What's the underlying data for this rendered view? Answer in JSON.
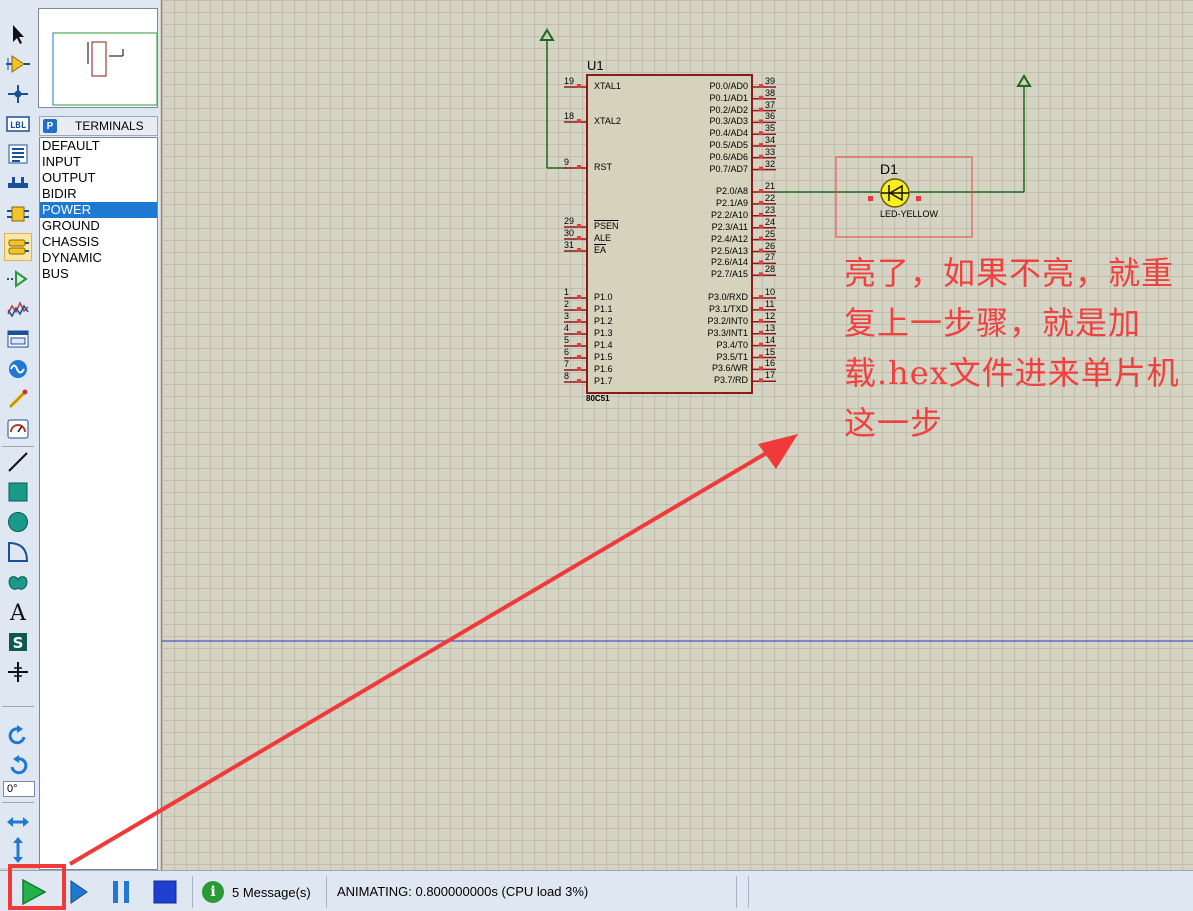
{
  "colors": {
    "annotation_red": "#f04040",
    "wire_green": "#1c6b1c",
    "chip_outline": "#8b1a1a",
    "chip_fill": "#d5d3bb",
    "selection_blue": "#1f78d1"
  },
  "toolbar": {
    "tools": [
      "selection-mode-icon",
      "component-mode-icon",
      "junction-dot-icon",
      "wire-label-icon",
      "text-script-icon",
      "buses-icon",
      "subcircuit-icon",
      "terminals-icon",
      "device-pins-icon",
      "graph-icon",
      "tape-recorder-icon",
      "generator-icon",
      "voltage-probe-icon",
      "virtual-instruments-icon",
      "line-icon",
      "box-icon",
      "circle-icon",
      "arc-icon",
      "closed-path-icon",
      "text-icon",
      "symbol-icon",
      "marker-icon",
      "rotate-clockwise-icon",
      "rotate-anticlockwise-icon",
      "mirror-x-icon",
      "mirror-y-icon"
    ],
    "angle_value": "0°"
  },
  "side_panel": {
    "badge": "P",
    "title": "TERMINALS",
    "items": [
      "DEFAULT",
      "INPUT",
      "OUTPUT",
      "BIDIR",
      "POWER",
      "GROUND",
      "CHASSIS",
      "DYNAMIC",
      "BUS"
    ],
    "selected": "POWER"
  },
  "schematic": {
    "chip": {
      "ref": "U1",
      "part": "80C51",
      "left_pins": [
        {
          "num": "19",
          "name": "XTAL1"
        },
        {
          "num": "18",
          "name": "XTAL2"
        },
        {
          "num": "9",
          "name": "RST"
        },
        {
          "num": "29",
          "name": "PSEN"
        },
        {
          "num": "30",
          "name": "ALE"
        },
        {
          "num": "31",
          "name": "EA"
        },
        {
          "num": "1",
          "name": "P1.0"
        },
        {
          "num": "2",
          "name": "P1.1"
        },
        {
          "num": "3",
          "name": "P1.2"
        },
        {
          "num": "4",
          "name": "P1.3"
        },
        {
          "num": "5",
          "name": "P1.4"
        },
        {
          "num": "6",
          "name": "P1.5"
        },
        {
          "num": "7",
          "name": "P1.6"
        },
        {
          "num": "8",
          "name": "P1.7"
        }
      ],
      "right_pins": [
        {
          "num": "39",
          "name": "P0.0/AD0"
        },
        {
          "num": "38",
          "name": "P0.1/AD1"
        },
        {
          "num": "37",
          "name": "P0.2/AD2"
        },
        {
          "num": "36",
          "name": "P0.3/AD3"
        },
        {
          "num": "35",
          "name": "P0.4/AD4"
        },
        {
          "num": "34",
          "name": "P0.5/AD5"
        },
        {
          "num": "33",
          "name": "P0.6/AD6"
        },
        {
          "num": "32",
          "name": "P0.7/AD7"
        },
        {
          "num": "21",
          "name": "P2.0/A8"
        },
        {
          "num": "22",
          "name": "P2.1/A9"
        },
        {
          "num": "23",
          "name": "P2.2/A10"
        },
        {
          "num": "24",
          "name": "P2.3/A11"
        },
        {
          "num": "25",
          "name": "P2.4/A12"
        },
        {
          "num": "26",
          "name": "P2.5/A13"
        },
        {
          "num": "27",
          "name": "P2.6/A14"
        },
        {
          "num": "28",
          "name": "P2.7/A15"
        },
        {
          "num": "10",
          "name": "P3.0/RXD"
        },
        {
          "num": "11",
          "name": "P3.1/TXD"
        },
        {
          "num": "12",
          "name": "P3.2/INT0"
        },
        {
          "num": "13",
          "name": "P3.3/INT1"
        },
        {
          "num": "14",
          "name": "P3.4/T0"
        },
        {
          "num": "15",
          "name": "P3.5/T1"
        },
        {
          "num": "16",
          "name": "P3.6/WR"
        },
        {
          "num": "17",
          "name": "P3.7/RD"
        }
      ]
    },
    "led": {
      "ref": "D1",
      "part": "LED-YELLOW"
    },
    "annotation": "亮了，如果不亮，就重复上一步骤，就是加载.hex文件进来单片机这一步"
  },
  "status_bar": {
    "controls": [
      "play-icon",
      "step-icon",
      "pause-icon",
      "stop-icon"
    ],
    "messages": "5 Message(s)",
    "animating": "ANIMATING: 0.800000000s (CPU load 3%)"
  }
}
